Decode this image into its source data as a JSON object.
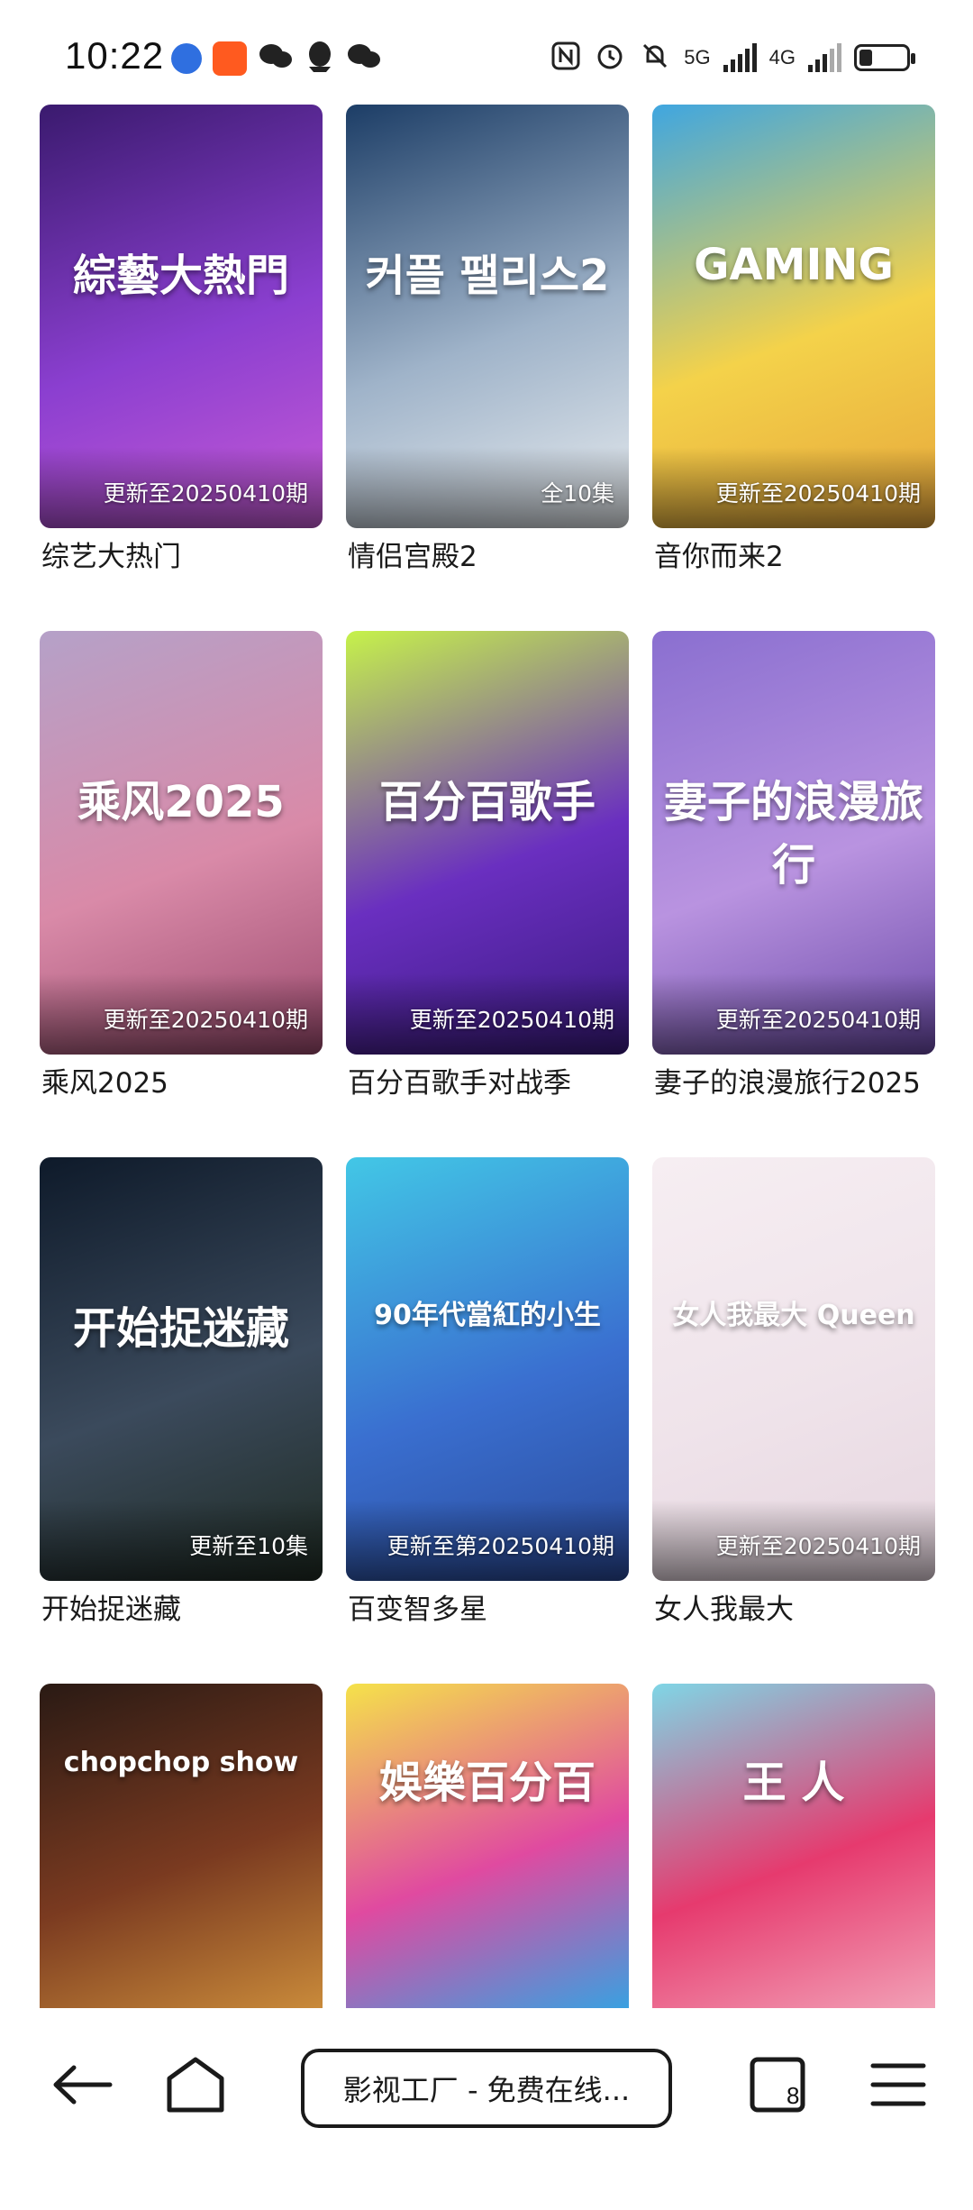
{
  "status_bar": {
    "time": "10:22",
    "network_1": "5G",
    "network_2": "4G"
  },
  "shows": [
    {
      "title": "综艺大热门",
      "badge": "更新至20250410期",
      "art": "綜藝大熱門",
      "colors": [
        "#3a1a6e",
        "#8b3fd0",
        "#c85bd6"
      ]
    },
    {
      "title": "情侣宫殿2",
      "badge": "全10集",
      "art": "커플 팰리스2",
      "colors": [
        "#1c3d66",
        "#9fb3c9",
        "#e8ecef"
      ]
    },
    {
      "title": "音你而来2",
      "badge": "更新至20250410期",
      "art": "GAMING",
      "colors": [
        "#3fa6e0",
        "#f4d24a",
        "#e6a63b"
      ]
    },
    {
      "title": "乘风2025",
      "badge": "更新至20250410期",
      "art": "乘风2025",
      "colors": [
        "#b5a1c8",
        "#d98aa8",
        "#9c4a6e"
      ]
    },
    {
      "title": "百分百歌手对战季",
      "badge": "更新至20250410期",
      "art": "百分百歌手",
      "colors": [
        "#c6f24a",
        "#6a2fc0",
        "#3a1a80"
      ]
    },
    {
      "title": "妻子的浪漫旅行2025",
      "badge": "更新至20250410期",
      "art": "妻子的浪漫旅行",
      "colors": [
        "#8a6fd0",
        "#b993e0",
        "#6b4aa8"
      ]
    },
    {
      "title": "开始捉迷藏",
      "badge": "更新至10集",
      "art": "开始捉迷藏",
      "colors": [
        "#0e1a2a",
        "#3b4a5c",
        "#1f2b23"
      ]
    },
    {
      "title": "百变智多星",
      "badge": "更新至第20250410期",
      "art": "90年代當紅的小生",
      "colors": [
        "#42c7e6",
        "#3a6fd0",
        "#2a4a9a"
      ]
    },
    {
      "title": "女人我最大",
      "badge": "更新至20250410期",
      "art": "女人我最大 Queen",
      "colors": [
        "#f6eef2",
        "#efe3ea",
        "#e6d6df"
      ]
    },
    {
      "title": "",
      "badge": "",
      "art": "chopchop show",
      "colors": [
        "#2a1a14",
        "#7a3a20",
        "#c98a3a"
      ]
    },
    {
      "title": "",
      "badge": "",
      "art": "娛樂百分百",
      "colors": [
        "#f5e24a",
        "#e04aa0",
        "#3aa0e0"
      ]
    },
    {
      "title": "",
      "badge": "",
      "art": "王 人",
      "colors": [
        "#7fd6e6",
        "#e63a6e",
        "#f2a0b6"
      ]
    }
  ],
  "bottom_bar": {
    "url_text": "影视工厂 - 免费在线...",
    "tab_count": "8"
  }
}
